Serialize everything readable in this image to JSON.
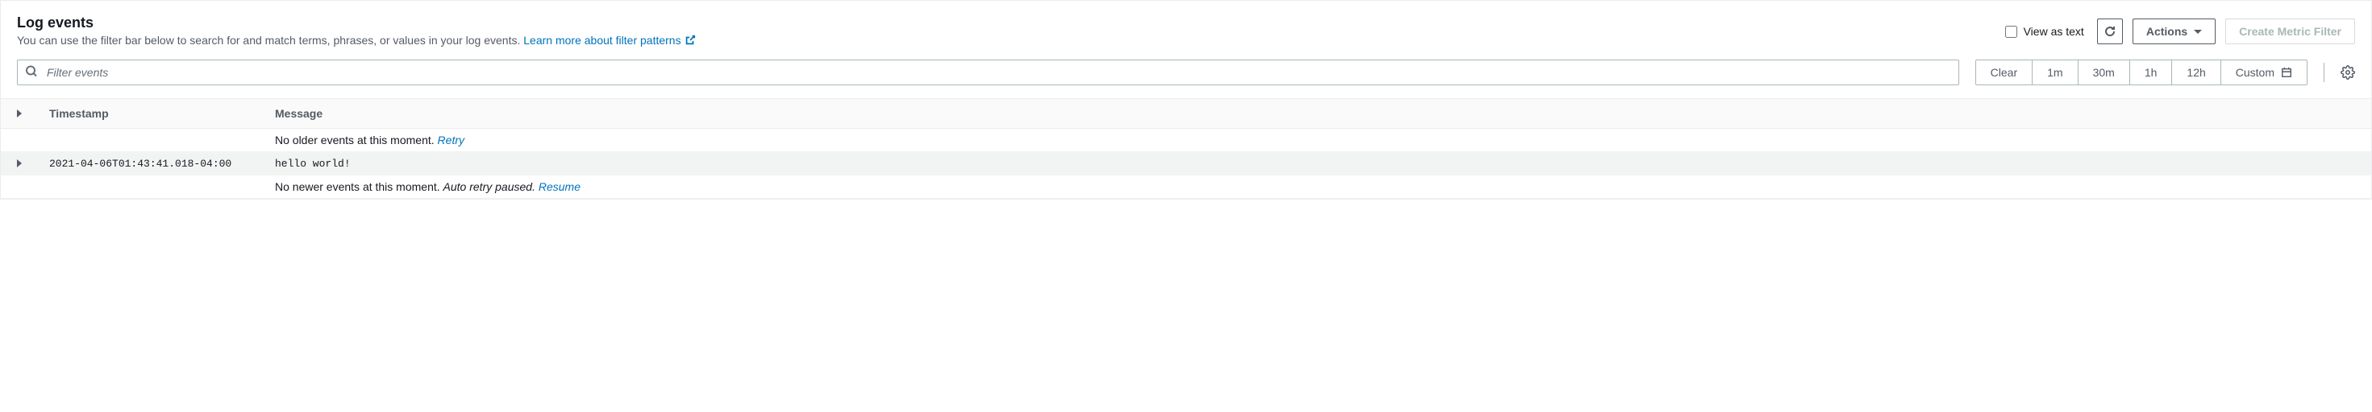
{
  "header": {
    "title": "Log events",
    "subtitle": "You can use the filter bar below to search for and match terms, phrases, or values in your log events. ",
    "learn_link": "Learn more about filter patterns"
  },
  "controls": {
    "view_as_text": "View as text",
    "actions": "Actions",
    "create_filter": "Create Metric Filter"
  },
  "filter": {
    "placeholder": "Filter events"
  },
  "time": {
    "clear": "Clear",
    "m1": "1m",
    "m30": "30m",
    "h1": "1h",
    "h12": "12h",
    "custom": "Custom"
  },
  "table": {
    "col_timestamp": "Timestamp",
    "col_message": "Message",
    "no_older": "No older events at this moment. ",
    "retry": "Retry",
    "no_newer_a": "No newer events at this moment. ",
    "no_newer_b": "Auto retry paused. ",
    "resume": "Resume",
    "rows": [
      {
        "timestamp": "2021-04-06T01:43:41.018-04:00",
        "message": "hello world!"
      }
    ]
  }
}
